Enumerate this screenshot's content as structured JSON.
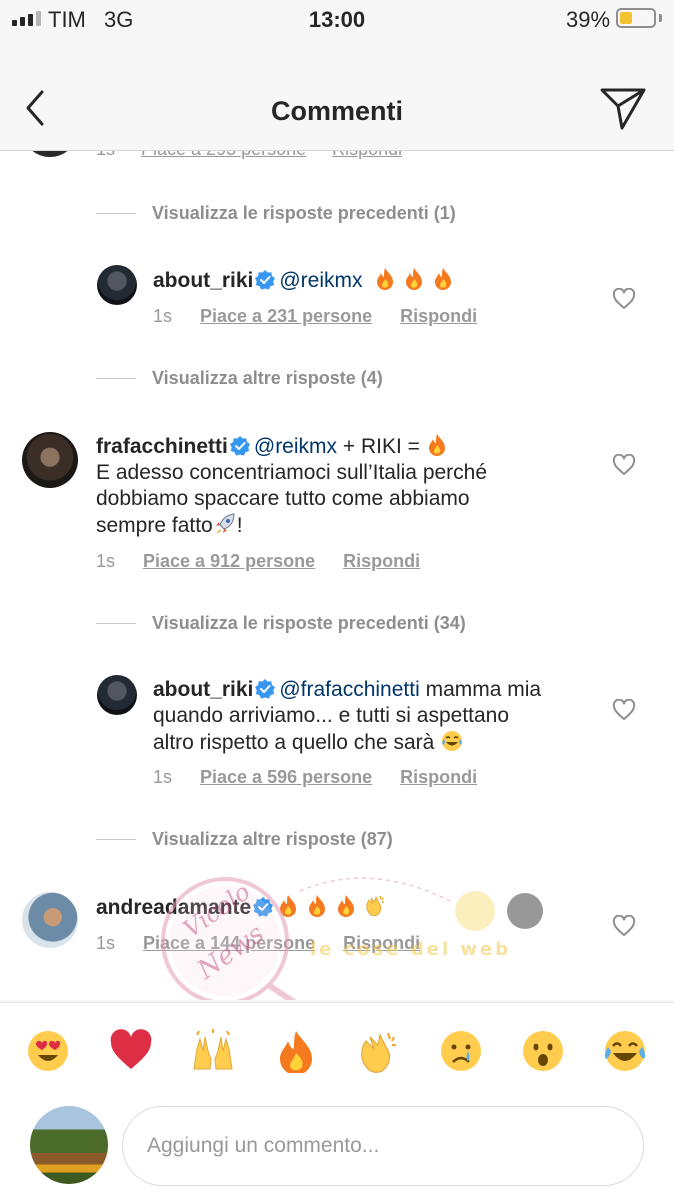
{
  "status_bar": {
    "carrier": "TIM",
    "network": "3G",
    "time": "13:00",
    "battery_percent": "39%",
    "battery_level": 0.39
  },
  "header": {
    "title": "Commenti",
    "back_icon": "chevron-left-icon",
    "send_icon": "paper-plane-icon"
  },
  "partial_comment": {
    "time": "1s",
    "likes": "Piace a 293 persone",
    "reply": "Rispondi"
  },
  "view_replies": [
    {
      "text": "Visualizza le risposte precedenti (1)"
    },
    {
      "text": "Visualizza altre risposte (4)"
    },
    {
      "text": "Visualizza le risposte precedenti (34)"
    },
    {
      "text": "Visualizza altre risposte (87)"
    }
  ],
  "comments": [
    {
      "username": "about_riki",
      "verified": true,
      "mention": "@reikmx",
      "text_lines": [],
      "emojis": [
        "fire",
        "fire",
        "fire"
      ],
      "time": "1s",
      "likes": "Piace a 231 persone",
      "reply": "Rispondi"
    },
    {
      "username": "frafacchinetti",
      "verified": true,
      "mention": "@reikmx",
      "inline_text": " + RIKI = ",
      "emojis": [
        "fire"
      ],
      "text_lines": [
        "E adesso concentriamoci sull’Italia perché",
        "dobbiamo spaccare tutto come abbiamo",
        "sempre fatto"
      ],
      "trailing": "!",
      "trailing_emoji": "rocket",
      "time": "1s",
      "likes": "Piace a 912 persone",
      "reply": "Rispondi"
    },
    {
      "username": "about_riki",
      "verified": true,
      "mention": "@frafacchinetti",
      "inline_text": " mamma mia",
      "text_lines": [
        "quando arriviamo... e tutti si aspettano",
        "altro rispetto a quello che sarà"
      ],
      "trailing_emoji": "joy",
      "time": "1s",
      "likes": "Piace a 596 persone",
      "reply": "Rispondi"
    },
    {
      "username": "andreadamante",
      "verified": true,
      "emojis": [
        "fire",
        "fire",
        "fire",
        "clap"
      ],
      "time": "1s",
      "likes": "Piace a 144 persone",
      "reply": "Rispondi"
    }
  ],
  "watermark": {
    "brand": "Vicolo delle News",
    "tagline": "...le cose del web"
  },
  "quick_emojis": [
    "heart-eyes-icon",
    "red-heart-icon",
    "raised-hands-icon",
    "fire-icon",
    "clapping-hands-icon",
    "crying-face-icon",
    "surprised-face-icon",
    "laughing-tears-icon"
  ],
  "composer": {
    "placeholder": "Aggiungi un commento..."
  },
  "colors": {
    "mention": "#003569",
    "verified": "#3897f0",
    "meta": "#999999",
    "text": "#262626"
  }
}
